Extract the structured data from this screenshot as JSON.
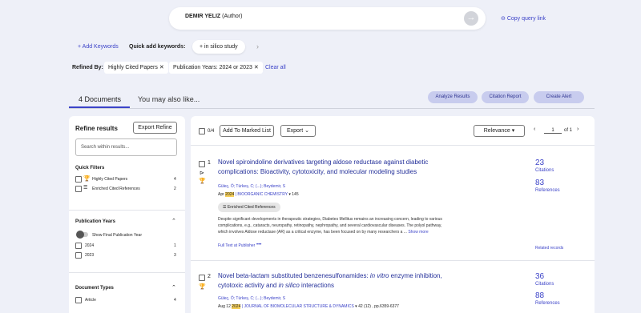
{
  "query": {
    "author": "DEMIR YELIZ",
    "role": " (Author)",
    "copy_link": "Copy query link"
  },
  "keywords": {
    "add": "+ Add Keywords",
    "quick_label": "Quick add keywords:",
    "chip": "+ in silico study"
  },
  "refined": {
    "label": "Refined By:",
    "chips": [
      "Highly Cited Papers",
      "Publication Years: 2024 or 2023"
    ],
    "clear": "Clear all"
  },
  "tabs": {
    "documents": "4 Documents",
    "maylike": "You may also like..."
  },
  "actions": {
    "analyze": "Analyze Results",
    "citation": "Citation Report",
    "alert": "Create Alert"
  },
  "sidebar": {
    "title": "Refine results",
    "export": "Export Refine",
    "search_placeholder": "Search within results...",
    "quick_filters": "Quick Filters",
    "qf_items": [
      {
        "label": "Highly Cited Papers",
        "count": "4"
      },
      {
        "label": "Enriched Cited References",
        "count": "2"
      }
    ],
    "pub_years": "Publication Years",
    "show_final": "Show Final Publication Year",
    "years": [
      {
        "label": "2024",
        "count": "1"
      },
      {
        "label": "2023",
        "count": "3"
      }
    ],
    "doc_types": "Document Types",
    "dt_items": [
      {
        "label": "Article",
        "count": "4"
      }
    ]
  },
  "toolbar": {
    "count": "0/4",
    "add_marked": "Add To Marked List",
    "export": "Export",
    "sort": "Relevance",
    "page": "1",
    "of": "of 1"
  },
  "records": [
    {
      "num": "1",
      "title_a": "Novel spiroindoline derivatives targeting aldose reductase against diabetic",
      "title_b": "complications: Bioactivity, cytotoxicity, and molecular modeling studies",
      "authors": "Güleç, Ö; Türkeș, C; (...); Beydemir, S",
      "date_pre": "Apr ",
      "year": "2024",
      "journal": " | BIOORGANIC CHEMISTRY",
      "vol": "145",
      "enriched": "Enriched Cited References",
      "abstract1": "Despite significant developments in therapeutic strategies, Diabetes Mellitus remains an increasing concern, leading to various",
      "abstract2": "complications, e.g., cataracts, neuropathy, retinopathy, nephropathy, and several cardiovascular diseases. The polyol pathway,",
      "abstract3": "which involves Aldose reductase (AR) as a critical enzyme, has been focused on by many researchers a ...",
      "show_more": "Show more",
      "full_text": "Full Text at Publisher",
      "more": "•••",
      "citations": "23",
      "citations_label": "Citations",
      "references": "83",
      "references_label": "References",
      "related": "Related records"
    },
    {
      "num": "2",
      "title_a": "Novel beta-lactam substituted benzenesulfonamides: ",
      "title_it1": "in vitro",
      "title_b": " enzyme inhibition,",
      "title_c": "cytotoxic activity and ",
      "title_it2": "in silico",
      "title_d": " interactions",
      "authors": "Güleç, Ö; Türkeș, C; (...); Beydemir, S",
      "date_pre": "Aug 12 ",
      "year": "2024",
      "journal": " | JOURNAL OF BIOMOLECULAR STRUCTURE & DYNAMICS",
      "vol": "42 (12) , pp.6359-6377",
      "citations": "36",
      "citations_label": "Citations",
      "references": "88",
      "references_label": "References"
    }
  ]
}
